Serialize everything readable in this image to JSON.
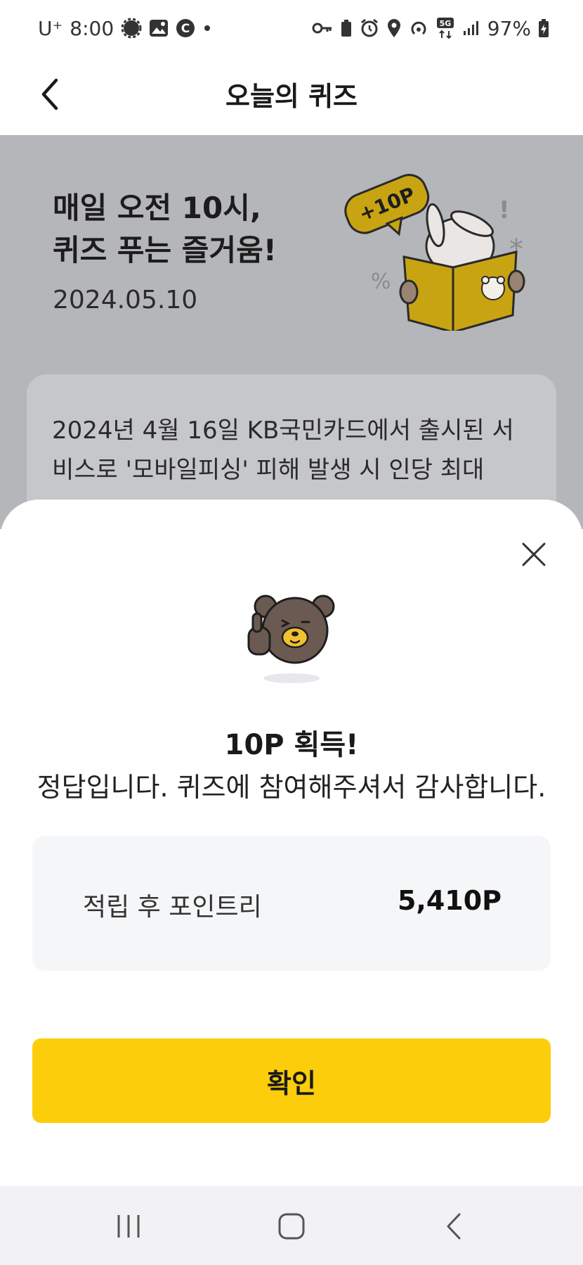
{
  "status_bar": {
    "carrier": "U⁺",
    "time": "8:00",
    "battery": "97%",
    "network": "5G"
  },
  "header": {
    "title": "오늘의 퀴즈"
  },
  "hero": {
    "title_line1": "매일 오전 10시,",
    "title_line2": "퀴즈 푸는 즐거움!",
    "date": "2024.05.10",
    "badge": "+10P"
  },
  "question": {
    "line1": "2024년 4월 16일 KB국민카드에서 출시된 서",
    "line2": "비스로 '모바일피싱' 피해 발생 시 인당 최대"
  },
  "result_sheet": {
    "title": "10P 획득!",
    "message": "정답입니다. 퀴즈에 참여해주셔서 감사합니다.",
    "points_label": "적립 후 포인트리",
    "points_value": "5,410P",
    "confirm_label": "확인"
  },
  "colors": {
    "accent": "#fccd0a",
    "dim_background": "#b5b6b9",
    "card_background": "#f5f6f8"
  },
  "icons": {
    "back": "chevron-left-icon",
    "close": "close-icon",
    "nav_recent": "recent-apps-icon",
    "nav_home": "home-icon",
    "nav_back": "nav-back-icon"
  }
}
